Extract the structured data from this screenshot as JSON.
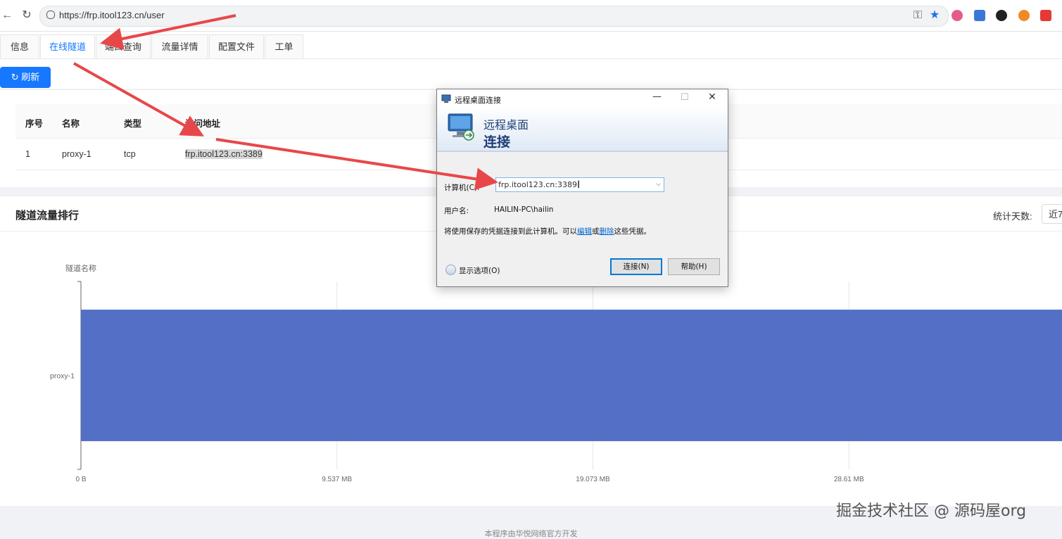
{
  "browser": {
    "url": "https://frp.itool123.cn/user"
  },
  "tabs": [
    {
      "label": "信息",
      "active": false
    },
    {
      "label": "在线隧道",
      "active": true
    },
    {
      "label": "端口查询",
      "active": false
    },
    {
      "label": "流量详情",
      "active": false
    },
    {
      "label": "配置文件",
      "active": false
    },
    {
      "label": "工单",
      "active": false
    }
  ],
  "toolbar": {
    "refresh_label": "刷新"
  },
  "table": {
    "headers": [
      "序号",
      "名称",
      "类型",
      "访问地址"
    ],
    "rows": [
      [
        "1",
        "proxy-1",
        "tcp",
        "frp.itool123.cn:3389"
      ]
    ]
  },
  "traffic": {
    "title": "隧道流量排行",
    "days_label": "统计天数:",
    "days_value": "近7"
  },
  "chart_data": {
    "type": "bar",
    "orientation": "horizontal",
    "ylabel": "隧道名称",
    "categories": [
      "proxy-1"
    ],
    "values": [
      38.5
    ],
    "value_unit": "MB",
    "x_ticks": [
      "0 B",
      "9.537 MB",
      "19.073 MB",
      "28.61 MB"
    ],
    "xlim": [
      0,
      38.147
    ],
    "color": "#5470c6",
    "grid": true
  },
  "dialog": {
    "window_title": "远程桌面连接",
    "banner_line1": "远程桌面",
    "banner_line2": "连接",
    "computer_label": "计算机(C):",
    "computer_value": "frp.itool123.cn:3389",
    "user_label": "用户名:",
    "user_value": "HAILIN-PC\\hailin",
    "info_prefix": "将使用保存的凭据连接到此计算机。可以",
    "info_edit": "编辑",
    "info_or": "或",
    "info_delete": "删除",
    "info_suffix": "这些凭据。",
    "options_label": "显示选项(O)",
    "connect_label": "连接(N)",
    "help_label": "帮助(H)"
  },
  "footer": {
    "text": "本程序由华悦网络官方开发"
  },
  "watermark": "掘金技术社区 @ 源码屋org",
  "colors": {
    "accent": "#1677ff",
    "bar": "#5470c6",
    "arrow": "#e8474a"
  }
}
